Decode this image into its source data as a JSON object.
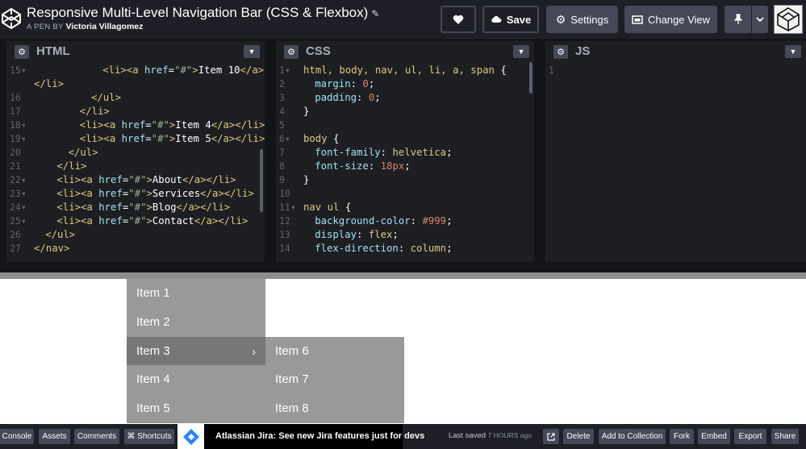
{
  "header": {
    "title": "Responsive Multi-Level Navigation Bar (CSS & Flexbox)",
    "byline_prefix": "A PEN BY",
    "author": "Victoria Villagomez",
    "buttons": {
      "save": "Save",
      "settings": "Settings",
      "change_view": "Change View"
    },
    "icons": [
      "codepen-logo-icon",
      "pencil-icon",
      "heart-icon",
      "cloud-icon",
      "gear-icon",
      "layout-icon",
      "pin-icon",
      "chevron-down-icon"
    ]
  },
  "editors": {
    "html": {
      "label": "HTML",
      "lines": [
        {
          "n": "15",
          "fold": true,
          "indent": 12,
          "parts": [
            [
              "tag",
              "<li>"
            ],
            [
              "tag",
              "<a "
            ],
            [
              "attr",
              "href"
            ],
            [
              "pun",
              "="
            ],
            [
              "str",
              "\"#\""
            ],
            [
              "tag",
              ">"
            ],
            [
              "pun",
              "Item 10"
            ],
            [
              "tag",
              "</a>"
            ]
          ]
        },
        {
          "n": "",
          "fold": false,
          "indent": 0,
          "parts": [
            [
              "tag",
              "</li>"
            ]
          ]
        },
        {
          "n": "16",
          "fold": false,
          "indent": 10,
          "parts": [
            [
              "tag",
              "</ul>"
            ]
          ]
        },
        {
          "n": "17",
          "fold": false,
          "indent": 8,
          "parts": [
            [
              "tag",
              "</li>"
            ]
          ]
        },
        {
          "n": "18",
          "fold": true,
          "indent": 8,
          "parts": [
            [
              "tag",
              "<li>"
            ],
            [
              "tag",
              "<a "
            ],
            [
              "attr",
              "href"
            ],
            [
              "pun",
              "="
            ],
            [
              "str",
              "\"#\""
            ],
            [
              "tag",
              ">"
            ],
            [
              "pun",
              "Item 4"
            ],
            [
              "tag",
              "</a></li>"
            ]
          ]
        },
        {
          "n": "19",
          "fold": true,
          "indent": 8,
          "parts": [
            [
              "tag",
              "<li>"
            ],
            [
              "tag",
              "<a "
            ],
            [
              "attr",
              "href"
            ],
            [
              "pun",
              "="
            ],
            [
              "str",
              "\"#\""
            ],
            [
              "tag",
              ">"
            ],
            [
              "pun",
              "Item 5"
            ],
            [
              "tag",
              "</a></li>"
            ]
          ]
        },
        {
          "n": "20",
          "fold": false,
          "indent": 6,
          "parts": [
            [
              "tag",
              "</ul>"
            ]
          ]
        },
        {
          "n": "21",
          "fold": false,
          "indent": 4,
          "parts": [
            [
              "tag",
              "</li>"
            ]
          ]
        },
        {
          "n": "22",
          "fold": true,
          "indent": 4,
          "parts": [
            [
              "tag",
              "<li>"
            ],
            [
              "tag",
              "<a "
            ],
            [
              "attr",
              "href"
            ],
            [
              "pun",
              "="
            ],
            [
              "str",
              "\"#\""
            ],
            [
              "tag",
              ">"
            ],
            [
              "pun",
              "About"
            ],
            [
              "tag",
              "</a></li>"
            ]
          ]
        },
        {
          "n": "23",
          "fold": true,
          "indent": 4,
          "parts": [
            [
              "tag",
              "<li>"
            ],
            [
              "tag",
              "<a "
            ],
            [
              "attr",
              "href"
            ],
            [
              "pun",
              "="
            ],
            [
              "str",
              "\"#\""
            ],
            [
              "tag",
              ">"
            ],
            [
              "pun",
              "Services"
            ],
            [
              "tag",
              "</a></li>"
            ]
          ]
        },
        {
          "n": "24",
          "fold": true,
          "indent": 4,
          "parts": [
            [
              "tag",
              "<li>"
            ],
            [
              "tag",
              "<a "
            ],
            [
              "attr",
              "href"
            ],
            [
              "pun",
              "="
            ],
            [
              "str",
              "\"#\""
            ],
            [
              "tag",
              ">"
            ],
            [
              "pun",
              "Blog"
            ],
            [
              "tag",
              "</a></li>"
            ]
          ]
        },
        {
          "n": "25",
          "fold": true,
          "indent": 4,
          "parts": [
            [
              "tag",
              "<li>"
            ],
            [
              "tag",
              "<a "
            ],
            [
              "attr",
              "href"
            ],
            [
              "pun",
              "="
            ],
            [
              "str",
              "\"#\""
            ],
            [
              "tag",
              ">"
            ],
            [
              "pun",
              "Contact"
            ],
            [
              "tag",
              "</a></li>"
            ]
          ]
        },
        {
          "n": "26",
          "fold": false,
          "indent": 2,
          "parts": [
            [
              "tag",
              "</ul>"
            ]
          ]
        },
        {
          "n": "27",
          "fold": false,
          "indent": 0,
          "parts": [
            [
              "tag",
              "</nav>"
            ]
          ]
        }
      ]
    },
    "css": {
      "label": "CSS",
      "lines": [
        {
          "n": "1",
          "fold": true,
          "indent": 0,
          "parts": [
            [
              "sel",
              "html, body, nav, ul, li, a, span"
            ],
            [
              "pun",
              " {"
            ]
          ]
        },
        {
          "n": "2",
          "fold": false,
          "indent": 2,
          "parts": [
            [
              "prop",
              "margin"
            ],
            [
              "pun",
              ": "
            ],
            [
              "num",
              "0"
            ],
            [
              "pun",
              ";"
            ]
          ]
        },
        {
          "n": "3",
          "fold": false,
          "indent": 2,
          "parts": [
            [
              "prop",
              "padding"
            ],
            [
              "pun",
              ": "
            ],
            [
              "num",
              "0"
            ],
            [
              "pun",
              ";"
            ]
          ]
        },
        {
          "n": "4",
          "fold": false,
          "indent": 0,
          "parts": [
            [
              "pun",
              "}"
            ]
          ]
        },
        {
          "n": "5",
          "fold": false,
          "indent": 0,
          "parts": []
        },
        {
          "n": "6",
          "fold": true,
          "indent": 0,
          "parts": [
            [
              "sel",
              "body"
            ],
            [
              "pun",
              " {"
            ]
          ]
        },
        {
          "n": "7",
          "fold": false,
          "indent": 2,
          "parts": [
            [
              "prop",
              "font-family"
            ],
            [
              "pun",
              ": "
            ],
            [
              "val",
              "helvetica"
            ],
            [
              "pun",
              ";"
            ]
          ]
        },
        {
          "n": "8",
          "fold": false,
          "indent": 2,
          "parts": [
            [
              "prop",
              "font-size"
            ],
            [
              "pun",
              ": "
            ],
            [
              "num",
              "18px"
            ],
            [
              "pun",
              ";"
            ]
          ]
        },
        {
          "n": "9",
          "fold": false,
          "indent": 0,
          "parts": [
            [
              "pun",
              "}"
            ]
          ]
        },
        {
          "n": "10",
          "fold": false,
          "indent": 0,
          "parts": []
        },
        {
          "n": "11",
          "fold": true,
          "indent": 0,
          "parts": [
            [
              "sel",
              "nav ul"
            ],
            [
              "pun",
              " {"
            ]
          ]
        },
        {
          "n": "12",
          "fold": false,
          "indent": 2,
          "parts": [
            [
              "prop",
              "background-color"
            ],
            [
              "pun",
              ": "
            ],
            [
              "num",
              "#999"
            ],
            [
              "pun",
              ";"
            ]
          ]
        },
        {
          "n": "13",
          "fold": false,
          "indent": 2,
          "parts": [
            [
              "prop",
              "display"
            ],
            [
              "pun",
              ": "
            ],
            [
              "val",
              "flex"
            ],
            [
              "pun",
              ";"
            ]
          ]
        },
        {
          "n": "14",
          "fold": false,
          "indent": 2,
          "parts": [
            [
              "prop",
              "flex-direction"
            ],
            [
              "pun",
              ": "
            ],
            [
              "val",
              "column"
            ],
            [
              "pun",
              ";"
            ]
          ]
        }
      ]
    },
    "js": {
      "label": "JS",
      "lines": [
        {
          "n": "1",
          "fold": false,
          "indent": 0,
          "parts": []
        }
      ]
    }
  },
  "preview": {
    "menu": [
      "Item 1",
      "Item 2",
      "Item 3",
      "Item 4",
      "Item 5"
    ],
    "active_item": "Item 3",
    "submenu": [
      "Item 6",
      "Item 7",
      "Item 8"
    ],
    "chevron": "›"
  },
  "footer": {
    "console": "Console",
    "assets": "Assets",
    "comments": "Comments",
    "shortcuts": "⌘ Shortcuts",
    "ad_text": "Atlassian Jira: See new Jira features just for devs",
    "saved_label": "Last saved",
    "saved_time": "7 HOURS ago",
    "delete": "Delete",
    "add_collection": "Add to Collection",
    "fork": "Fork",
    "embed": "Embed",
    "export": "Export",
    "share": "Share"
  },
  "colors": {
    "nav_bg": "#999",
    "nav_active": "#777",
    "header_bg": "#1e1f26",
    "editor_bg": "#1d1e22",
    "button_bg": "#444857",
    "ad_accent": "#2684ff"
  }
}
